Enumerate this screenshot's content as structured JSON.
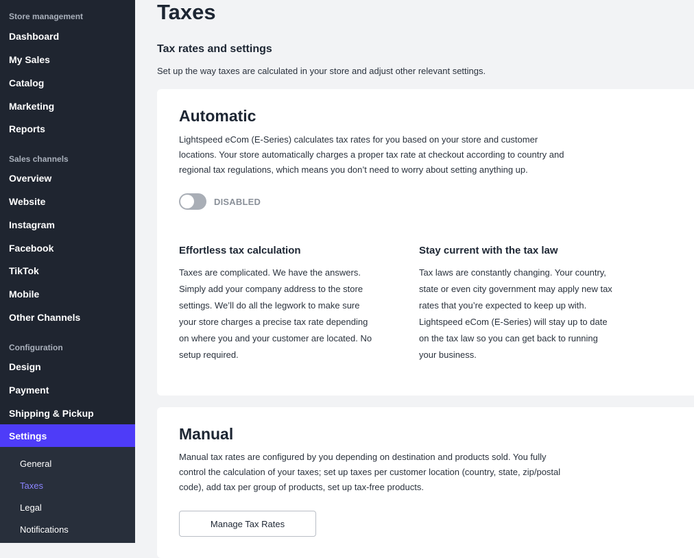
{
  "sidebar": {
    "sections": {
      "store": "Store management",
      "channels": "Sales channels",
      "config": "Configuration"
    },
    "store_items": [
      "Dashboard",
      "My Sales",
      "Catalog",
      "Marketing",
      "Reports"
    ],
    "channel_items": [
      "Overview",
      "Website",
      "Instagram",
      "Facebook",
      "TikTok",
      "Mobile",
      "Other Channels"
    ],
    "config_items": [
      "Design",
      "Payment",
      "Shipping & Pickup"
    ],
    "active_item": "Settings",
    "sub_items": [
      "General",
      "Taxes",
      "Legal",
      "Notifications"
    ],
    "active_sub": "Taxes",
    "active_color": "#4e3cf8"
  },
  "main": {
    "title": "Taxes",
    "section_title": "Tax rates and settings",
    "section_desc": "Set up the way taxes are calculated in your store and adjust other relevant settings.",
    "automatic": {
      "title": "Automatic",
      "lines": [
        "Lightspeed eCom (E-Series) calculates tax rates for you based on your store and customer",
        "locations. Your store automatically charges a proper tax rate at checkout according to country and",
        "regional tax regulations, which means you don’t need to worry about setting anything up."
      ],
      "toggle_state": "DISABLED",
      "features": [
        {
          "title": "Effortless tax calculation",
          "lines": [
            "Taxes are complicated. We have the answers.",
            "Simply add your company address to the store",
            "settings. We’ll do all the legwork to make sure",
            "your store charges a precise tax rate depending",
            "on where you and your customer are located. No",
            "setup required."
          ]
        },
        {
          "title": "Stay current with the tax law",
          "lines": [
            "Tax laws are constantly changing. Your country,",
            "state or even city government may apply new tax",
            "rates that you’re expected to keep up with.",
            "Lightspeed eCom (E-Series) will stay up to date",
            "on the tax law so you can get back to running",
            "your business."
          ]
        }
      ]
    },
    "manual": {
      "title": "Manual",
      "lines": [
        "Manual tax rates are configured by you depending on destination and products sold. You fully",
        "control the calculation of your taxes; set up taxes per customer location (country, state, zip/postal",
        "code), add tax per group of products, set up tax-free products."
      ],
      "button_label": "Manage Tax Rates"
    }
  }
}
